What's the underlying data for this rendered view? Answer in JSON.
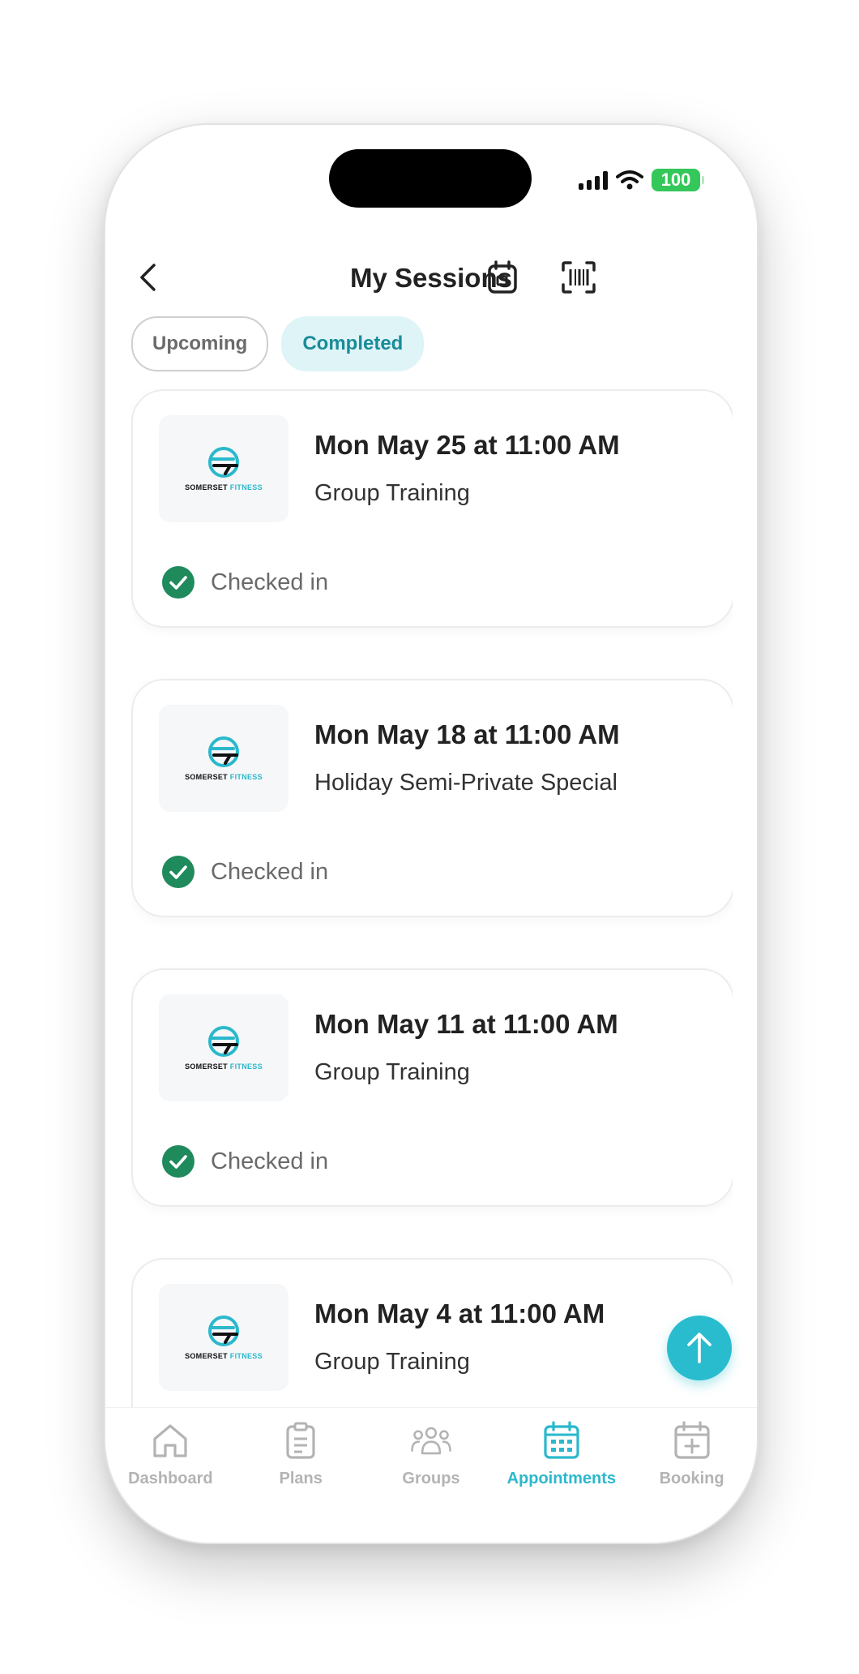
{
  "status_bar": {
    "battery": "100"
  },
  "header": {
    "title": "My Sessions",
    "back_icon": "chevron-left-icon",
    "calendar_icon": "calendar-icon",
    "barcode_icon": "barcode-scan-icon"
  },
  "tabs": [
    {
      "label": "Upcoming",
      "selected": false
    },
    {
      "label": "Completed",
      "selected": true
    }
  ],
  "logo": {
    "word1": "SOMERSET",
    "word2": "FITNESS"
  },
  "sessions": [
    {
      "date": "Mon May 25 at 11:00 AM",
      "name": "Group Training",
      "status": "Checked in"
    },
    {
      "date": "Mon May 18 at 11:00 AM",
      "name": "Holiday Semi-Private Special",
      "status": "Checked in"
    },
    {
      "date": "Mon May 11 at 11:00 AM",
      "name": "Group Training",
      "status": "Checked in"
    },
    {
      "date": "Mon May 4 at 11:00 AM",
      "name": "Group Training",
      "status": ""
    }
  ],
  "fab": {
    "icon": "arrow-up-icon"
  },
  "nav": [
    {
      "label": "Dashboard",
      "icon": "home-icon",
      "active": false
    },
    {
      "label": "Plans",
      "icon": "clipboard-icon",
      "active": false
    },
    {
      "label": "Groups",
      "icon": "group-icon",
      "active": false
    },
    {
      "label": "Appointments",
      "icon": "calendar-grid-icon",
      "active": true
    },
    {
      "label": "Booking",
      "icon": "calendar-plus-icon",
      "active": false
    }
  ],
  "colors": {
    "accent": "#2bb8cc",
    "check": "#1f8a5c",
    "chip_bg": "#def4f7"
  }
}
